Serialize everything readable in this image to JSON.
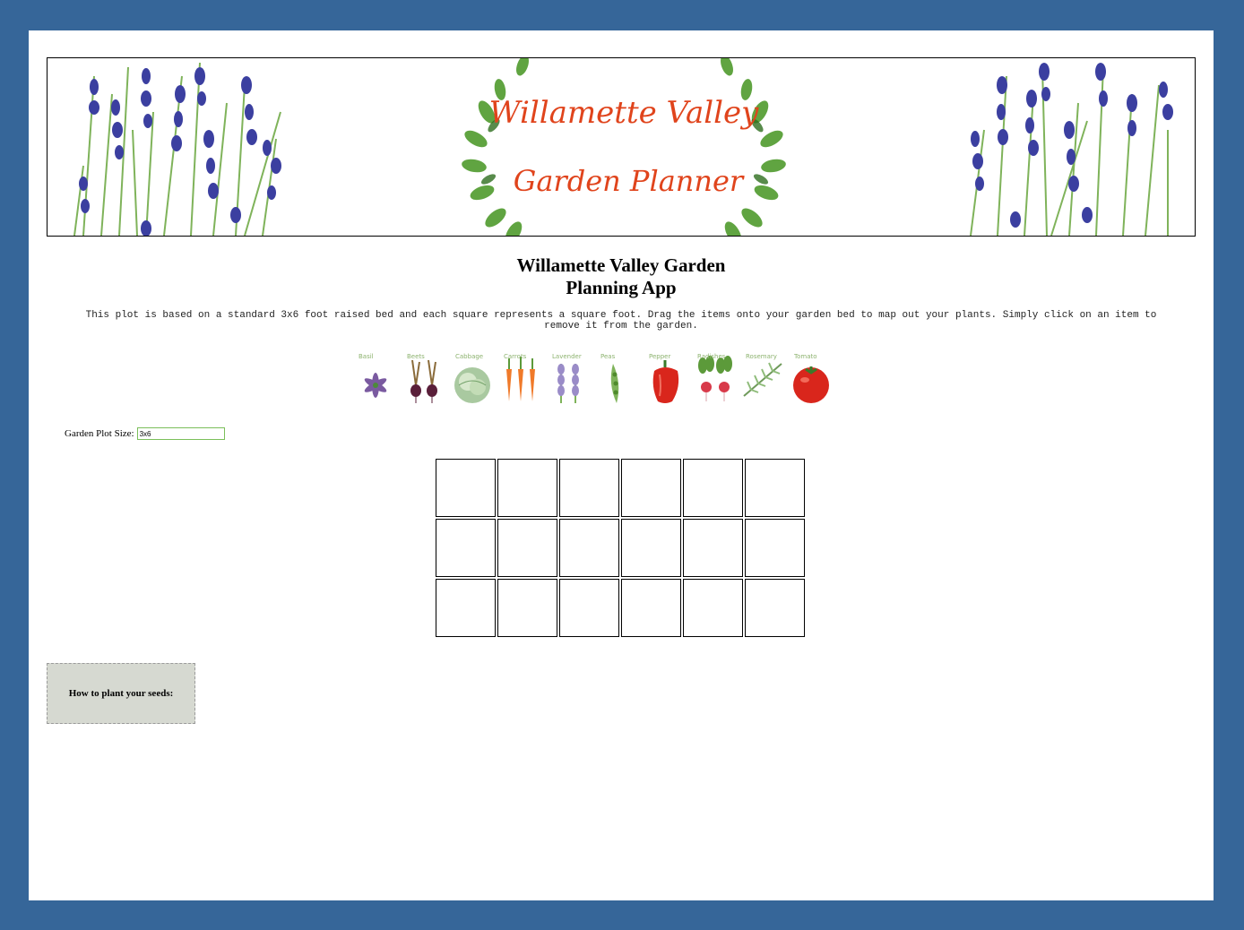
{
  "banner": {
    "line1": "Willamette Valley",
    "line2": "Garden Planner"
  },
  "title": {
    "line1": "Willamette Valley Garden",
    "line2": "Planning App"
  },
  "description": "This plot is based on a standard 3x6 foot raised bed and each square represents a square foot. Drag the items onto your garden bed to map out your plants. Simply click on an item to remove it from the garden.",
  "plants": [
    {
      "name": "Basil",
      "icon": "basil-icon"
    },
    {
      "name": "Beets",
      "icon": "beets-icon"
    },
    {
      "name": "Cabbage",
      "icon": "cabbage-icon"
    },
    {
      "name": "Carrots",
      "icon": "carrots-icon"
    },
    {
      "name": "Lavender",
      "icon": "lavender-icon"
    },
    {
      "name": "Peas",
      "icon": "peas-icon"
    },
    {
      "name": "Pepper",
      "icon": "pepper-icon"
    },
    {
      "name": "Radishes",
      "icon": "radishes-icon"
    },
    {
      "name": "Rosemary",
      "icon": "rosemary-icon"
    },
    {
      "name": "Tomato",
      "icon": "tomato-icon"
    }
  ],
  "plot_size": {
    "label": "Garden Plot Size:",
    "value": "3x6"
  },
  "grid": {
    "rows": 3,
    "cols": 6
  },
  "how_to": {
    "label": "How to plant your seeds:"
  },
  "colors": {
    "frame": "#366699",
    "banner_text": "#e0441c",
    "lavender": "#3b3fa0",
    "leaf": "#4f9a2c",
    "how_bg": "#d6d9d1"
  }
}
